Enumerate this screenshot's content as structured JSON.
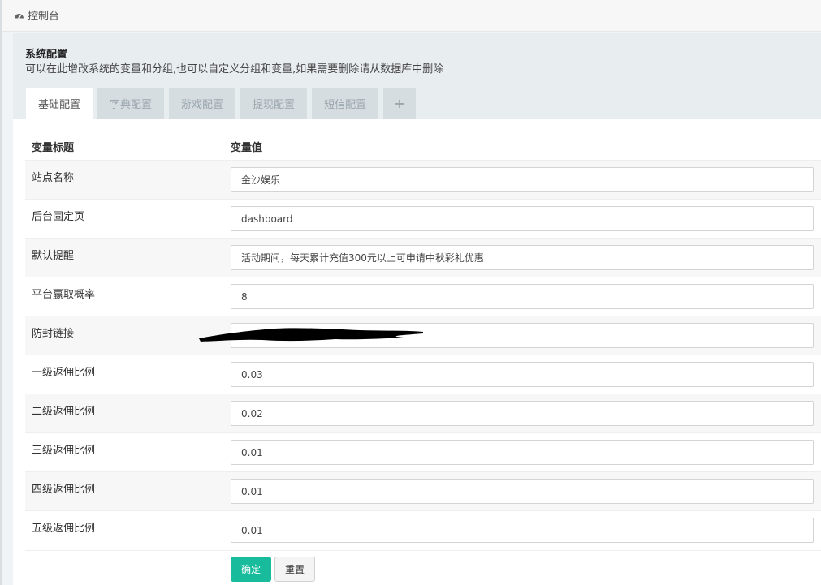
{
  "breadcrumb": {
    "icon": "dashboard-icon",
    "label": "控制台"
  },
  "panel": {
    "title": "系统配置",
    "description": "可以在此增改系统的变量和分组,也可以自定义分组和变量,如果需要删除请从数据库中删除"
  },
  "tabs": [
    {
      "label": "基础配置",
      "active": true
    },
    {
      "label": "字典配置",
      "active": false
    },
    {
      "label": "游戏配置",
      "active": false
    },
    {
      "label": "提现配置",
      "active": false
    },
    {
      "label": "短信配置",
      "active": false
    },
    {
      "label": "+",
      "active": false
    }
  ],
  "table": {
    "headers": [
      "变量标题",
      "变量值"
    ],
    "rows": [
      {
        "label": "站点名称",
        "value": "金沙娱乐"
      },
      {
        "label": "后台固定页",
        "value": "dashboard"
      },
      {
        "label": "默认提醒",
        "value": "活动期间，每天累计充值300元以上可申请中秋彩礼优惠"
      },
      {
        "label": "平台赢取概率",
        "value": "8"
      },
      {
        "label": "防封链接",
        "value": ""
      },
      {
        "label": "一级返佣比例",
        "value": "0.03"
      },
      {
        "label": "二级返佣比例",
        "value": "0.02"
      },
      {
        "label": "三级返佣比例",
        "value": "0.01"
      },
      {
        "label": "四级返佣比例",
        "value": "0.01"
      },
      {
        "label": "五级返佣比例",
        "value": "0.01"
      }
    ]
  },
  "buttons": {
    "confirm": "确定",
    "reset": "重置"
  },
  "colors": {
    "accent": "#18bc9c",
    "header_bg": "#e8edf0",
    "tab_inactive": "#d6dde1"
  }
}
